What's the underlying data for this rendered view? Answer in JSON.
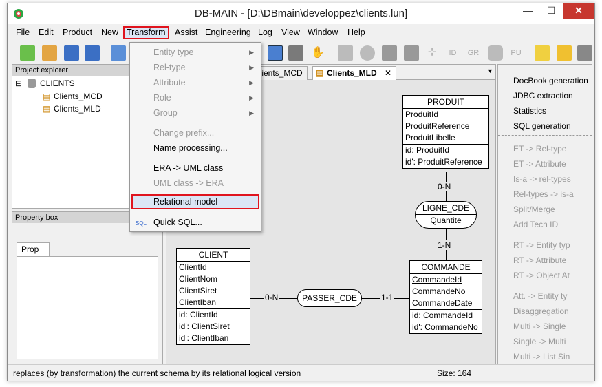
{
  "window": {
    "title": "DB-MAIN  - [D:\\DBmain\\developpez\\clients.lun]",
    "minimize": "—",
    "maximize": "☐",
    "close": "✕"
  },
  "menubar": {
    "items": [
      "File",
      "Edit",
      "Product",
      "New",
      "Transform",
      "Assist",
      "Engineering",
      "Log",
      "View",
      "Window",
      "Help"
    ]
  },
  "explorer": {
    "header": "Project explorer",
    "root": "CLIENTS",
    "children": [
      "Clients_MCD",
      "Clients_MLD"
    ]
  },
  "propbox": {
    "header": "Property box",
    "tab": "Prop"
  },
  "tabs": [
    "Clients_MCD",
    "Clients_MLD"
  ],
  "transform_menu": {
    "items": [
      {
        "label": "Entity type",
        "disabled": true,
        "submenu": true
      },
      {
        "label": "Rel-type",
        "disabled": true,
        "submenu": true
      },
      {
        "label": "Attribute",
        "disabled": true,
        "submenu": true
      },
      {
        "label": "Role",
        "disabled": true,
        "submenu": true
      },
      {
        "label": "Group",
        "disabled": true,
        "submenu": true
      },
      {
        "label": "Change prefix...",
        "disabled": true
      },
      {
        "label": "Name processing...",
        "disabled": false
      },
      {
        "label": "ERA -> UML class",
        "disabled": false
      },
      {
        "label": "UML class -> ERA",
        "disabled": true
      },
      {
        "label": "Relational model",
        "disabled": false
      },
      {
        "label": "Quick SQL...",
        "disabled": false
      }
    ]
  },
  "diagram": {
    "produit": {
      "name": "PRODUIT",
      "attrs": [
        "ProduitId",
        "ProduitReference",
        "ProduitLibelle"
      ],
      "ids": [
        "id: ProduitId",
        "id': ProduitReference"
      ]
    },
    "client": {
      "name": "CLIENT",
      "attrs": [
        "ClientId",
        "ClientNom",
        "ClientSiret",
        "ClientIban"
      ],
      "ids": [
        "id: ClientId",
        "id': ClientSiret",
        "id': ClientIban"
      ]
    },
    "commande": {
      "name": "COMMANDE",
      "attrs": [
        "CommandeId",
        "CommandeNo",
        "CommandeDate"
      ],
      "ids": [
        "id: CommandeId",
        "id': CommandeNo"
      ]
    },
    "ligne_cde": {
      "name": "LIGNE_CDE",
      "attr": "Quantite"
    },
    "passer_cde": {
      "name": "PASSER_CDE"
    },
    "cardinalities": {
      "produit_ligne": "0-N",
      "ligne_commande": "1-N",
      "client_passer": "0-N",
      "passer_commande": "1-1"
    }
  },
  "right_panel": {
    "top": [
      "DocBook generation",
      "JDBC extraction",
      "Statistics",
      "SQL generation"
    ],
    "disabled": [
      "ET -> Rel-type",
      "ET -> Attribute",
      "Is-a -> rel-types",
      "Rel-types -> is-a",
      "Split/Merge",
      "Add Tech ID",
      "RT -> Entity typ",
      "RT -> Attribute",
      "RT -> Object At",
      "Att. -> Entity ty",
      "Disaggregation",
      "Multi -> Single",
      "Single -> Multi",
      "Multi -> List Sin"
    ]
  },
  "toolbar_labels": [
    "ID",
    "GR",
    "PU"
  ],
  "status": {
    "message": "replaces (by transformation) the current schema by its relational logical version",
    "size": "Size: 164"
  },
  "colors": {
    "highlight": "#e0141e",
    "selection": "#dbe6f5"
  }
}
